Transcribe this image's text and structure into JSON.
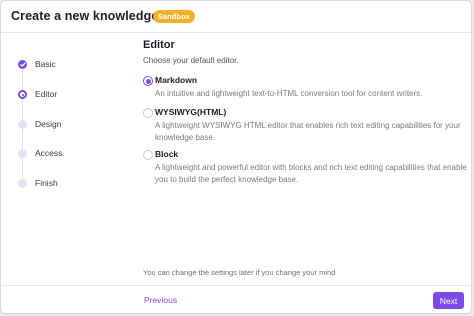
{
  "dialog": {
    "title": "Create a new knowledge base",
    "badge": "Sandbox"
  },
  "steps": [
    {
      "label": "Basic",
      "state": "done"
    },
    {
      "label": "Editor",
      "state": "active"
    },
    {
      "label": "Design",
      "state": "pending"
    },
    {
      "label": "Access",
      "state": "pending"
    },
    {
      "label": "Finish",
      "state": "pending"
    }
  ],
  "editor": {
    "title": "Editor",
    "subtitle": "Choose your default editor.",
    "options": [
      {
        "name": "Markdown",
        "description": "An intuitive and lightweight text-to-HTML conversion tool for content writers.",
        "selected": true
      },
      {
        "name": "WYSIWYG(HTML)",
        "description": "A lightweight WYSIWYG HTML editor that enables rich text editing capabilities for your knowledge base.",
        "selected": false
      },
      {
        "name": "Block",
        "description": "A lightweight and powerful editor with blocks and rich text editing capabilities that enable you to build the perfect knowledge base.",
        "selected": false
      }
    ]
  },
  "footnote": "You can change the settings later if you change your mind",
  "buttons": {
    "previous": "Previous",
    "next": "Next"
  },
  "colors": {
    "accent": "#7b4be8",
    "badge": "#f0b128"
  }
}
